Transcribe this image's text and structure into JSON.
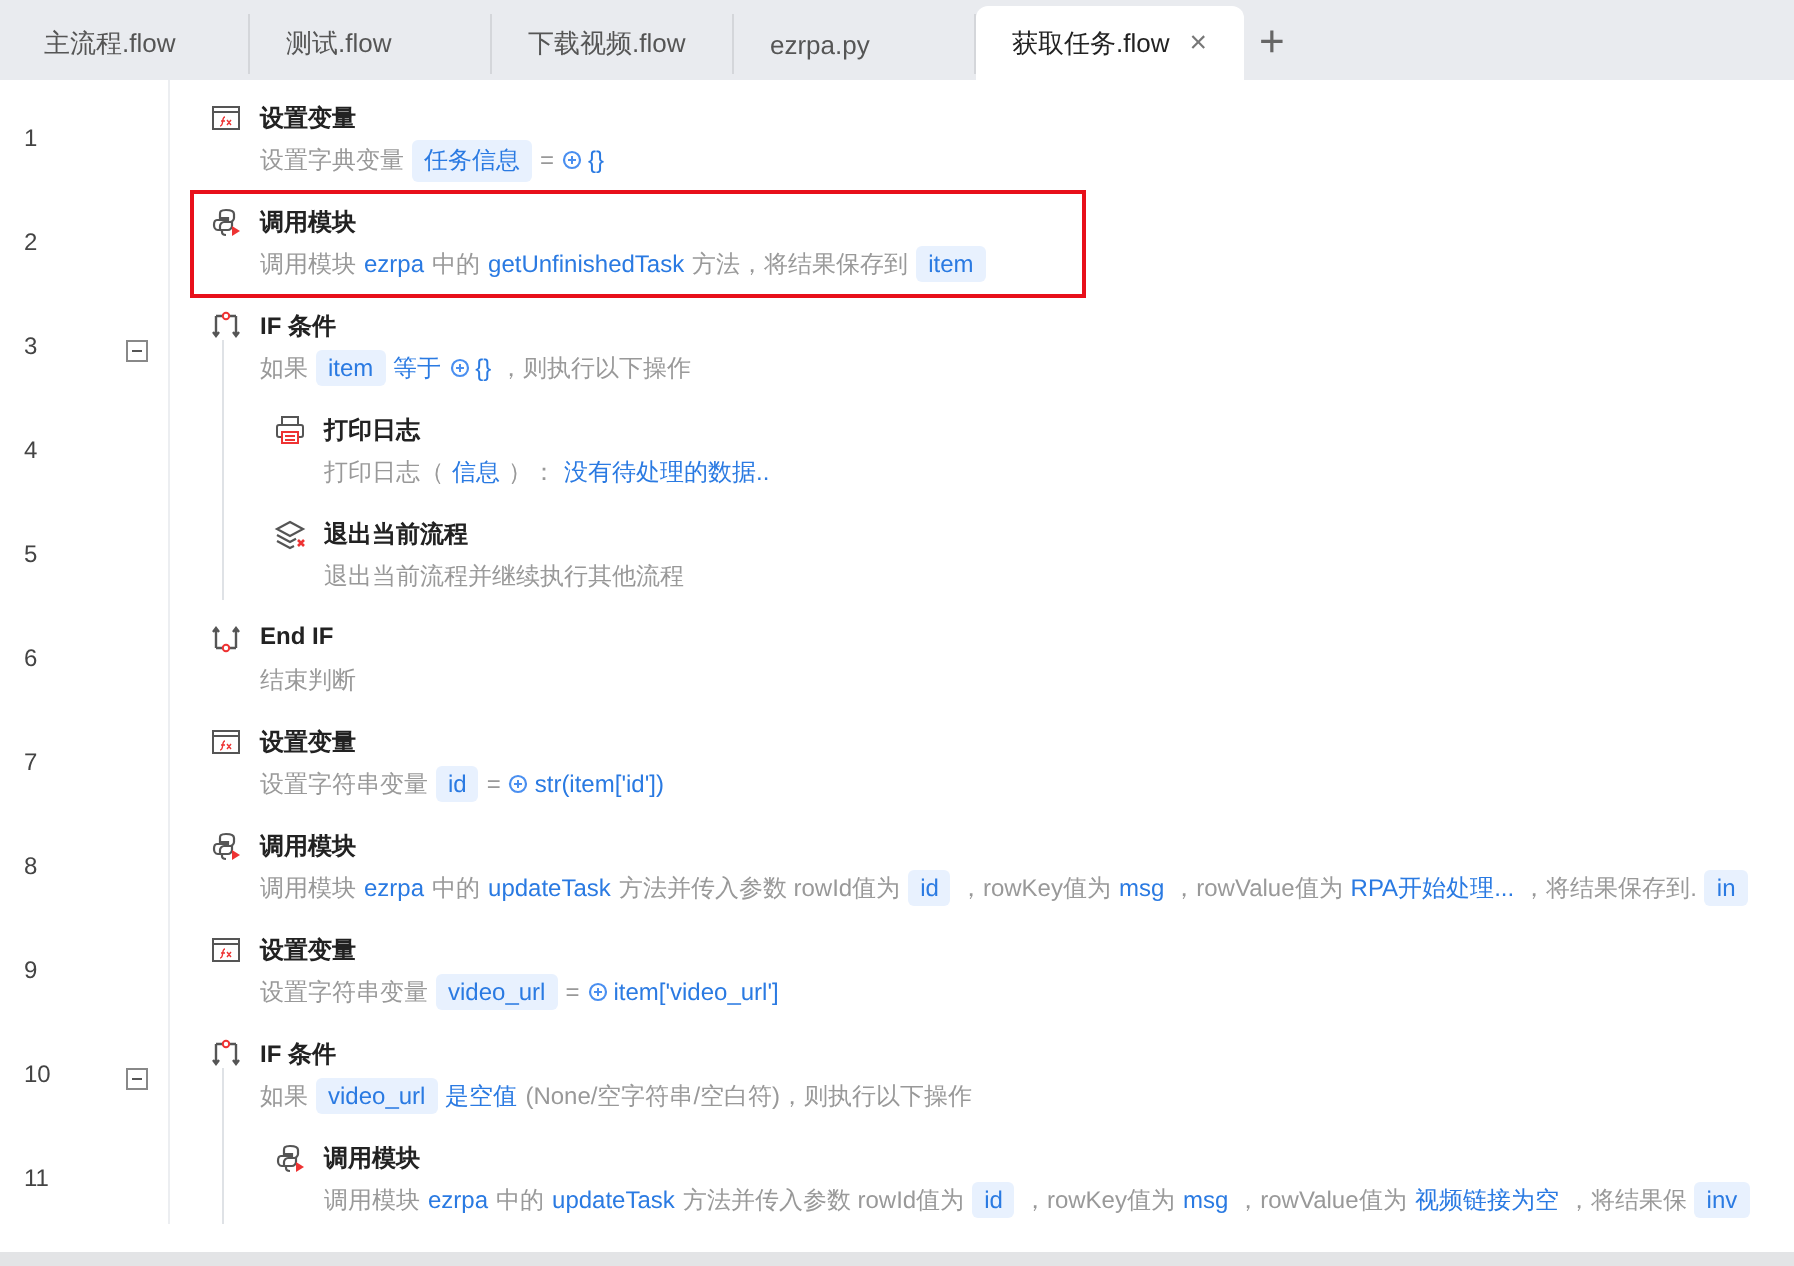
{
  "tabs": [
    {
      "label": "主流程.flow",
      "selected": false
    },
    {
      "label": "测试.flow",
      "selected": false
    },
    {
      "label": "下载视频.flow",
      "selected": false
    },
    {
      "label": "ezrpa.py",
      "selected": false
    },
    {
      "label": "获取任务.flow",
      "selected": true,
      "close": "×"
    }
  ],
  "add_tab": "+",
  "steps": [
    {
      "line": "1",
      "kind": "variable",
      "title": "设置变量",
      "selected": false,
      "desc": [
        {
          "kind": "text",
          "text": "设置字典变量"
        },
        {
          "kind": "var",
          "text": "任务信息"
        },
        {
          "kind": "text",
          "text": "="
        },
        {
          "kind": "expr",
          "text": "{}"
        }
      ]
    },
    {
      "line": "2",
      "kind": "module",
      "title": "调用模块",
      "selected": true,
      "desc": [
        {
          "kind": "text",
          "text": "调用模块"
        },
        {
          "kind": "link",
          "text": "ezrpa"
        },
        {
          "kind": "text",
          "text": "中的"
        },
        {
          "kind": "link",
          "text": "getUnfinishedTask"
        },
        {
          "kind": "text",
          "text": "方法，将结果保存到"
        },
        {
          "kind": "var",
          "text": "item"
        }
      ]
    },
    {
      "line": "3",
      "kind": "if",
      "title": "IF 条件",
      "selected": false,
      "expanded": true,
      "desc": [
        {
          "kind": "text",
          "text": "如果"
        },
        {
          "kind": "var",
          "text": "item"
        },
        {
          "kind": "link",
          "text": "等于"
        },
        {
          "kind": "expr",
          "text": "{}"
        },
        {
          "kind": "text",
          "text": "，则执行以下操作"
        }
      ],
      "children": [
        {
          "line": "4",
          "kind": "log",
          "title": "打印日志",
          "selected": false,
          "desc": [
            {
              "kind": "text",
              "text": "打印日志（"
            },
            {
              "kind": "link",
              "text": "信息"
            },
            {
              "kind": "text",
              "text": "）："
            },
            {
              "kind": "link",
              "text": "没有待处理的数据.."
            }
          ]
        },
        {
          "line": "5",
          "kind": "exit",
          "title": "退出当前流程",
          "selected": false,
          "desc": [
            {
              "kind": "text",
              "text": "退出当前流程并继续执行其他流程"
            }
          ]
        }
      ]
    },
    {
      "line": "6",
      "kind": "endif",
      "title": "End IF",
      "selected": false,
      "desc": [
        {
          "kind": "text",
          "text": "结束判断"
        }
      ]
    },
    {
      "line": "7",
      "kind": "variable",
      "title": "设置变量",
      "selected": false,
      "desc": [
        {
          "kind": "text",
          "text": "设置字符串变量"
        },
        {
          "kind": "var",
          "text": "id"
        },
        {
          "kind": "text",
          "text": "="
        },
        {
          "kind": "expr",
          "text": "str(item['id'])"
        }
      ]
    },
    {
      "line": "8",
      "kind": "module",
      "title": "调用模块",
      "selected": false,
      "desc": [
        {
          "kind": "text",
          "text": "调用模块"
        },
        {
          "kind": "link",
          "text": "ezrpa"
        },
        {
          "kind": "text",
          "text": "中的"
        },
        {
          "kind": "link",
          "text": "updateTask"
        },
        {
          "kind": "text",
          "text": "方法并传入参数 rowId值为"
        },
        {
          "kind": "var",
          "text": "id"
        },
        {
          "kind": "text",
          "text": "，rowKey值为"
        },
        {
          "kind": "link",
          "text": "msg"
        },
        {
          "kind": "text",
          "text": "，rowValue值为"
        },
        {
          "kind": "link",
          "text": "RPA开始处理..."
        },
        {
          "kind": "text",
          "text": "，将结果保存到."
        },
        {
          "kind": "var",
          "text": "in"
        }
      ]
    },
    {
      "line": "9",
      "kind": "variable",
      "title": "设置变量",
      "selected": false,
      "desc": [
        {
          "kind": "text",
          "text": "设置字符串变量"
        },
        {
          "kind": "var",
          "text": "video_url"
        },
        {
          "kind": "text",
          "text": "="
        },
        {
          "kind": "expr",
          "text": "item['video_url']"
        }
      ]
    },
    {
      "line": "10",
      "kind": "if",
      "title": "IF 条件",
      "selected": false,
      "expanded": true,
      "desc": [
        {
          "kind": "text",
          "text": "如果"
        },
        {
          "kind": "var",
          "text": "video_url"
        },
        {
          "kind": "link",
          "text": "是空值"
        },
        {
          "kind": "text",
          "text": "(None/空字符串/空白符)，则执行以下操作"
        }
      ],
      "children": [
        {
          "line": "11",
          "kind": "module",
          "title": "调用模块",
          "selected": false,
          "desc": [
            {
              "kind": "text",
              "text": "调用模块"
            },
            {
              "kind": "link",
              "text": "ezrpa"
            },
            {
              "kind": "text",
              "text": "中的"
            },
            {
              "kind": "link",
              "text": "updateTask"
            },
            {
              "kind": "text",
              "text": "方法并传入参数 rowId值为"
            },
            {
              "kind": "var",
              "text": "id"
            },
            {
              "kind": "text",
              "text": "，rowKey值为"
            },
            {
              "kind": "link",
              "text": "msg"
            },
            {
              "kind": "text",
              "text": "，rowValue值为"
            },
            {
              "kind": "link",
              "text": "视频链接为空"
            },
            {
              "kind": "text",
              "text": "，将结果保"
            },
            {
              "kind": "var",
              "text": "inv"
            }
          ]
        }
      ]
    }
  ]
}
